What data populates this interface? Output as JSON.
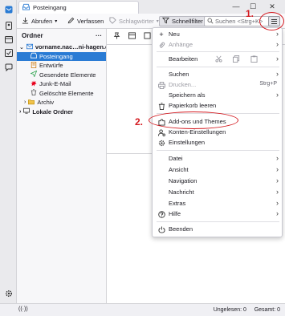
{
  "window": {
    "tab_title": "Posteingang",
    "minimize_glyph": "—",
    "maximize_glyph": "☐",
    "close_glyph": "✕"
  },
  "toolbar": {
    "get_mail": "Abrufen",
    "compose": "Verfassen",
    "tags": "Schlagwörter",
    "quick_filter": "Schnellfilter",
    "search_placeholder": "Suchen <Strg+K>"
  },
  "folder_pane": {
    "header": "Ordner",
    "more": "···",
    "account": "vorname.nac…ni-hagen.de",
    "folders": [
      {
        "label": "Posteingang",
        "icon": "inbox-icon",
        "selected": true
      },
      {
        "label": "Entwürfe",
        "icon": "drafts-icon"
      },
      {
        "label": "Gesendete Elemente",
        "icon": "sent-icon"
      },
      {
        "label": "Junk-E-Mail",
        "icon": "junk-icon"
      },
      {
        "label": "Gelöschte Elemente",
        "icon": "trash-icon"
      },
      {
        "label": "Archiv",
        "icon": "archive-folder-icon"
      }
    ],
    "local_folders": "Lokale Ordner"
  },
  "app_menu": {
    "new": "Neu",
    "attachments": "Anhänge",
    "edit": "Bearbeiten",
    "find": "Suchen",
    "print": "Drucken...",
    "print_shortcut": "Strg+P",
    "save_as": "Speichern als",
    "empty_trash": "Papierkorb leeren",
    "addons": "Add-ons und Themes",
    "account_settings": "Konten-Einstellungen",
    "settings": "Einstellungen",
    "file": "Datei",
    "view": "Ansicht",
    "navigation": "Navigation",
    "message": "Nachricht",
    "tools": "Extras",
    "help": "Hilfe",
    "quit": "Beenden"
  },
  "annotations": {
    "step1": "1.",
    "step2": "2."
  },
  "status_bar": {
    "unread": "Ungelesen: 0",
    "total": "Gesamt: 0"
  },
  "colors": {
    "accent": "#2a7bd4",
    "annotation": "#d41a20",
    "junk": "#e8001c",
    "sent": "#2ea44f"
  }
}
